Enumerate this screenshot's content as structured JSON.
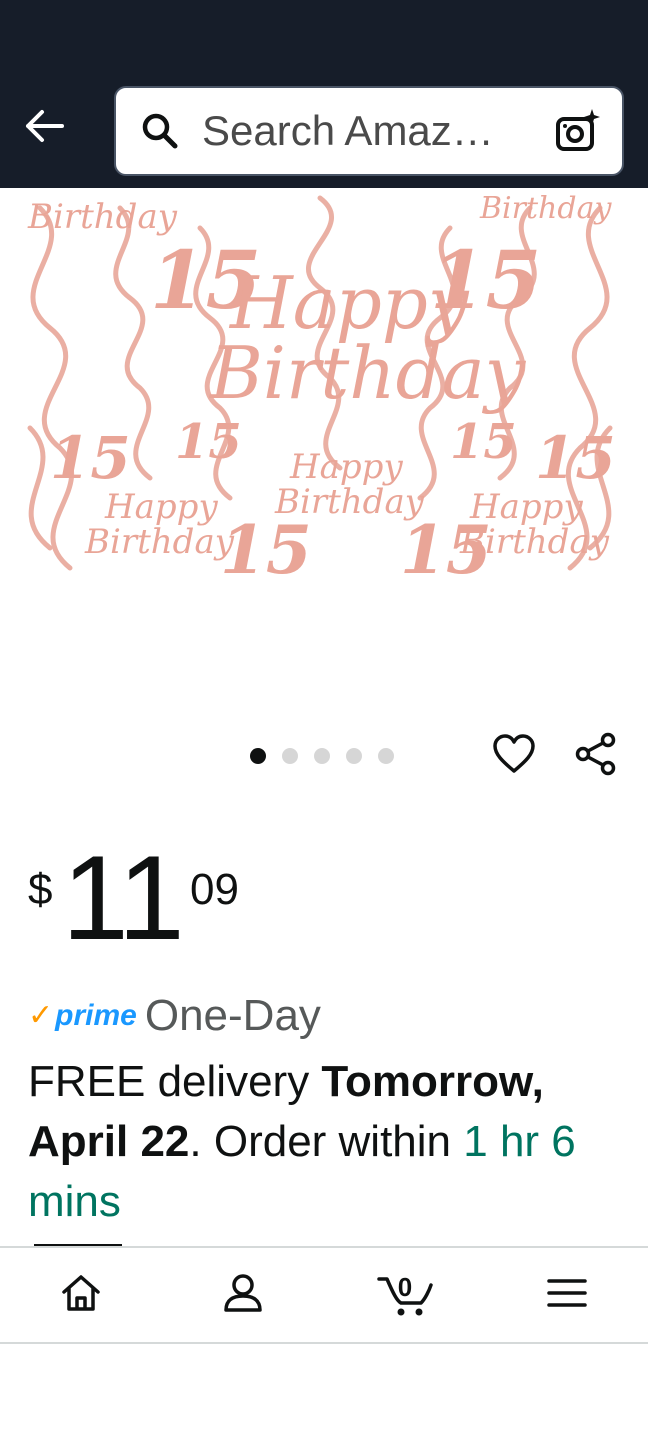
{
  "header": {
    "search_placeholder": "Search Amaz…",
    "back_icon": "back-arrow-icon",
    "search_icon": "search-icon",
    "camera_icon": "camera-search-icon",
    "background_color": "#161d29"
  },
  "product": {
    "image_alt": "Rose gold Happy Birthday 15 hanging swirl decorations",
    "image_text": {
      "happy": "Happy",
      "birthday": "Birthday",
      "number": "15"
    },
    "carousel": {
      "total_images": 5,
      "active_index": 0
    },
    "wishlist_icon": "heart-icon",
    "share_icon": "share-icon"
  },
  "price": {
    "currency": "$",
    "whole": "11",
    "fraction": "09"
  },
  "delivery": {
    "prime_check": "✓",
    "prime_label": "prime",
    "speed": "One-Day",
    "free_text": "FREE delivery ",
    "date": "Tomorrow, April 22",
    "order_text": ". Order within ",
    "countdown": "1 hr 6 mins",
    "countdown_color": "#007460",
    "prime_color": "#1a98ff",
    "prime_check_color": "#ff9900"
  },
  "bottom_nav": {
    "items": [
      {
        "icon": "home-icon"
      },
      {
        "icon": "account-icon"
      },
      {
        "icon": "cart-icon",
        "count": "0"
      },
      {
        "icon": "menu-icon"
      }
    ]
  }
}
